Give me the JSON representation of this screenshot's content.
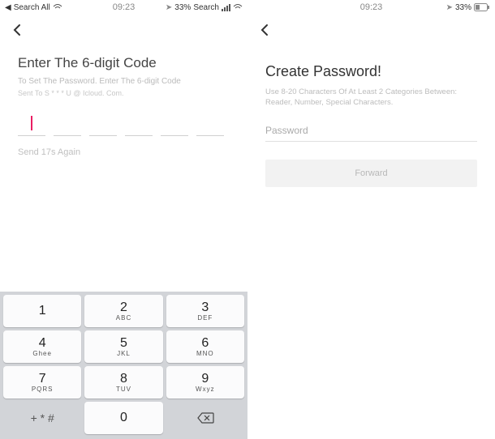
{
  "left": {
    "status": {
      "back_app": "Search All",
      "time": "09:23",
      "battery_pct": "33%",
      "battery_prefix": "Search"
    },
    "title": "Enter The 6-digit Code",
    "subtitle": "To Set The Password. Enter The 6-digit Code",
    "subtitle2": "Sent To S * * * U @ Icloud. Com.",
    "resend": "Send 17s Again",
    "keypad": {
      "k1": {
        "d": "1",
        "l": ""
      },
      "k2": {
        "d": "2",
        "l": "ABC"
      },
      "k3": {
        "d": "3",
        "l": "DEF"
      },
      "k4": {
        "d": "4",
        "l": "Ghee"
      },
      "k5": {
        "d": "5",
        "l": "JKL"
      },
      "k6": {
        "d": "6",
        "l": "MNO"
      },
      "k7": {
        "d": "7",
        "l": "PQRS"
      },
      "k8": {
        "d": "8",
        "l": "TUV"
      },
      "k9": {
        "d": "9",
        "l": "Wxyz"
      },
      "sym": "+ * #",
      "k0": {
        "d": "0",
        "l": ""
      }
    }
  },
  "right": {
    "status": {
      "time": "09:23",
      "battery_pct": "33%"
    },
    "title": "Create Password!",
    "desc": "Use 8-20 Characters Of At Least 2 Categories Between: Reader, Number, Special Characters.",
    "pw_placeholder": "Password",
    "forward": "Forward"
  }
}
